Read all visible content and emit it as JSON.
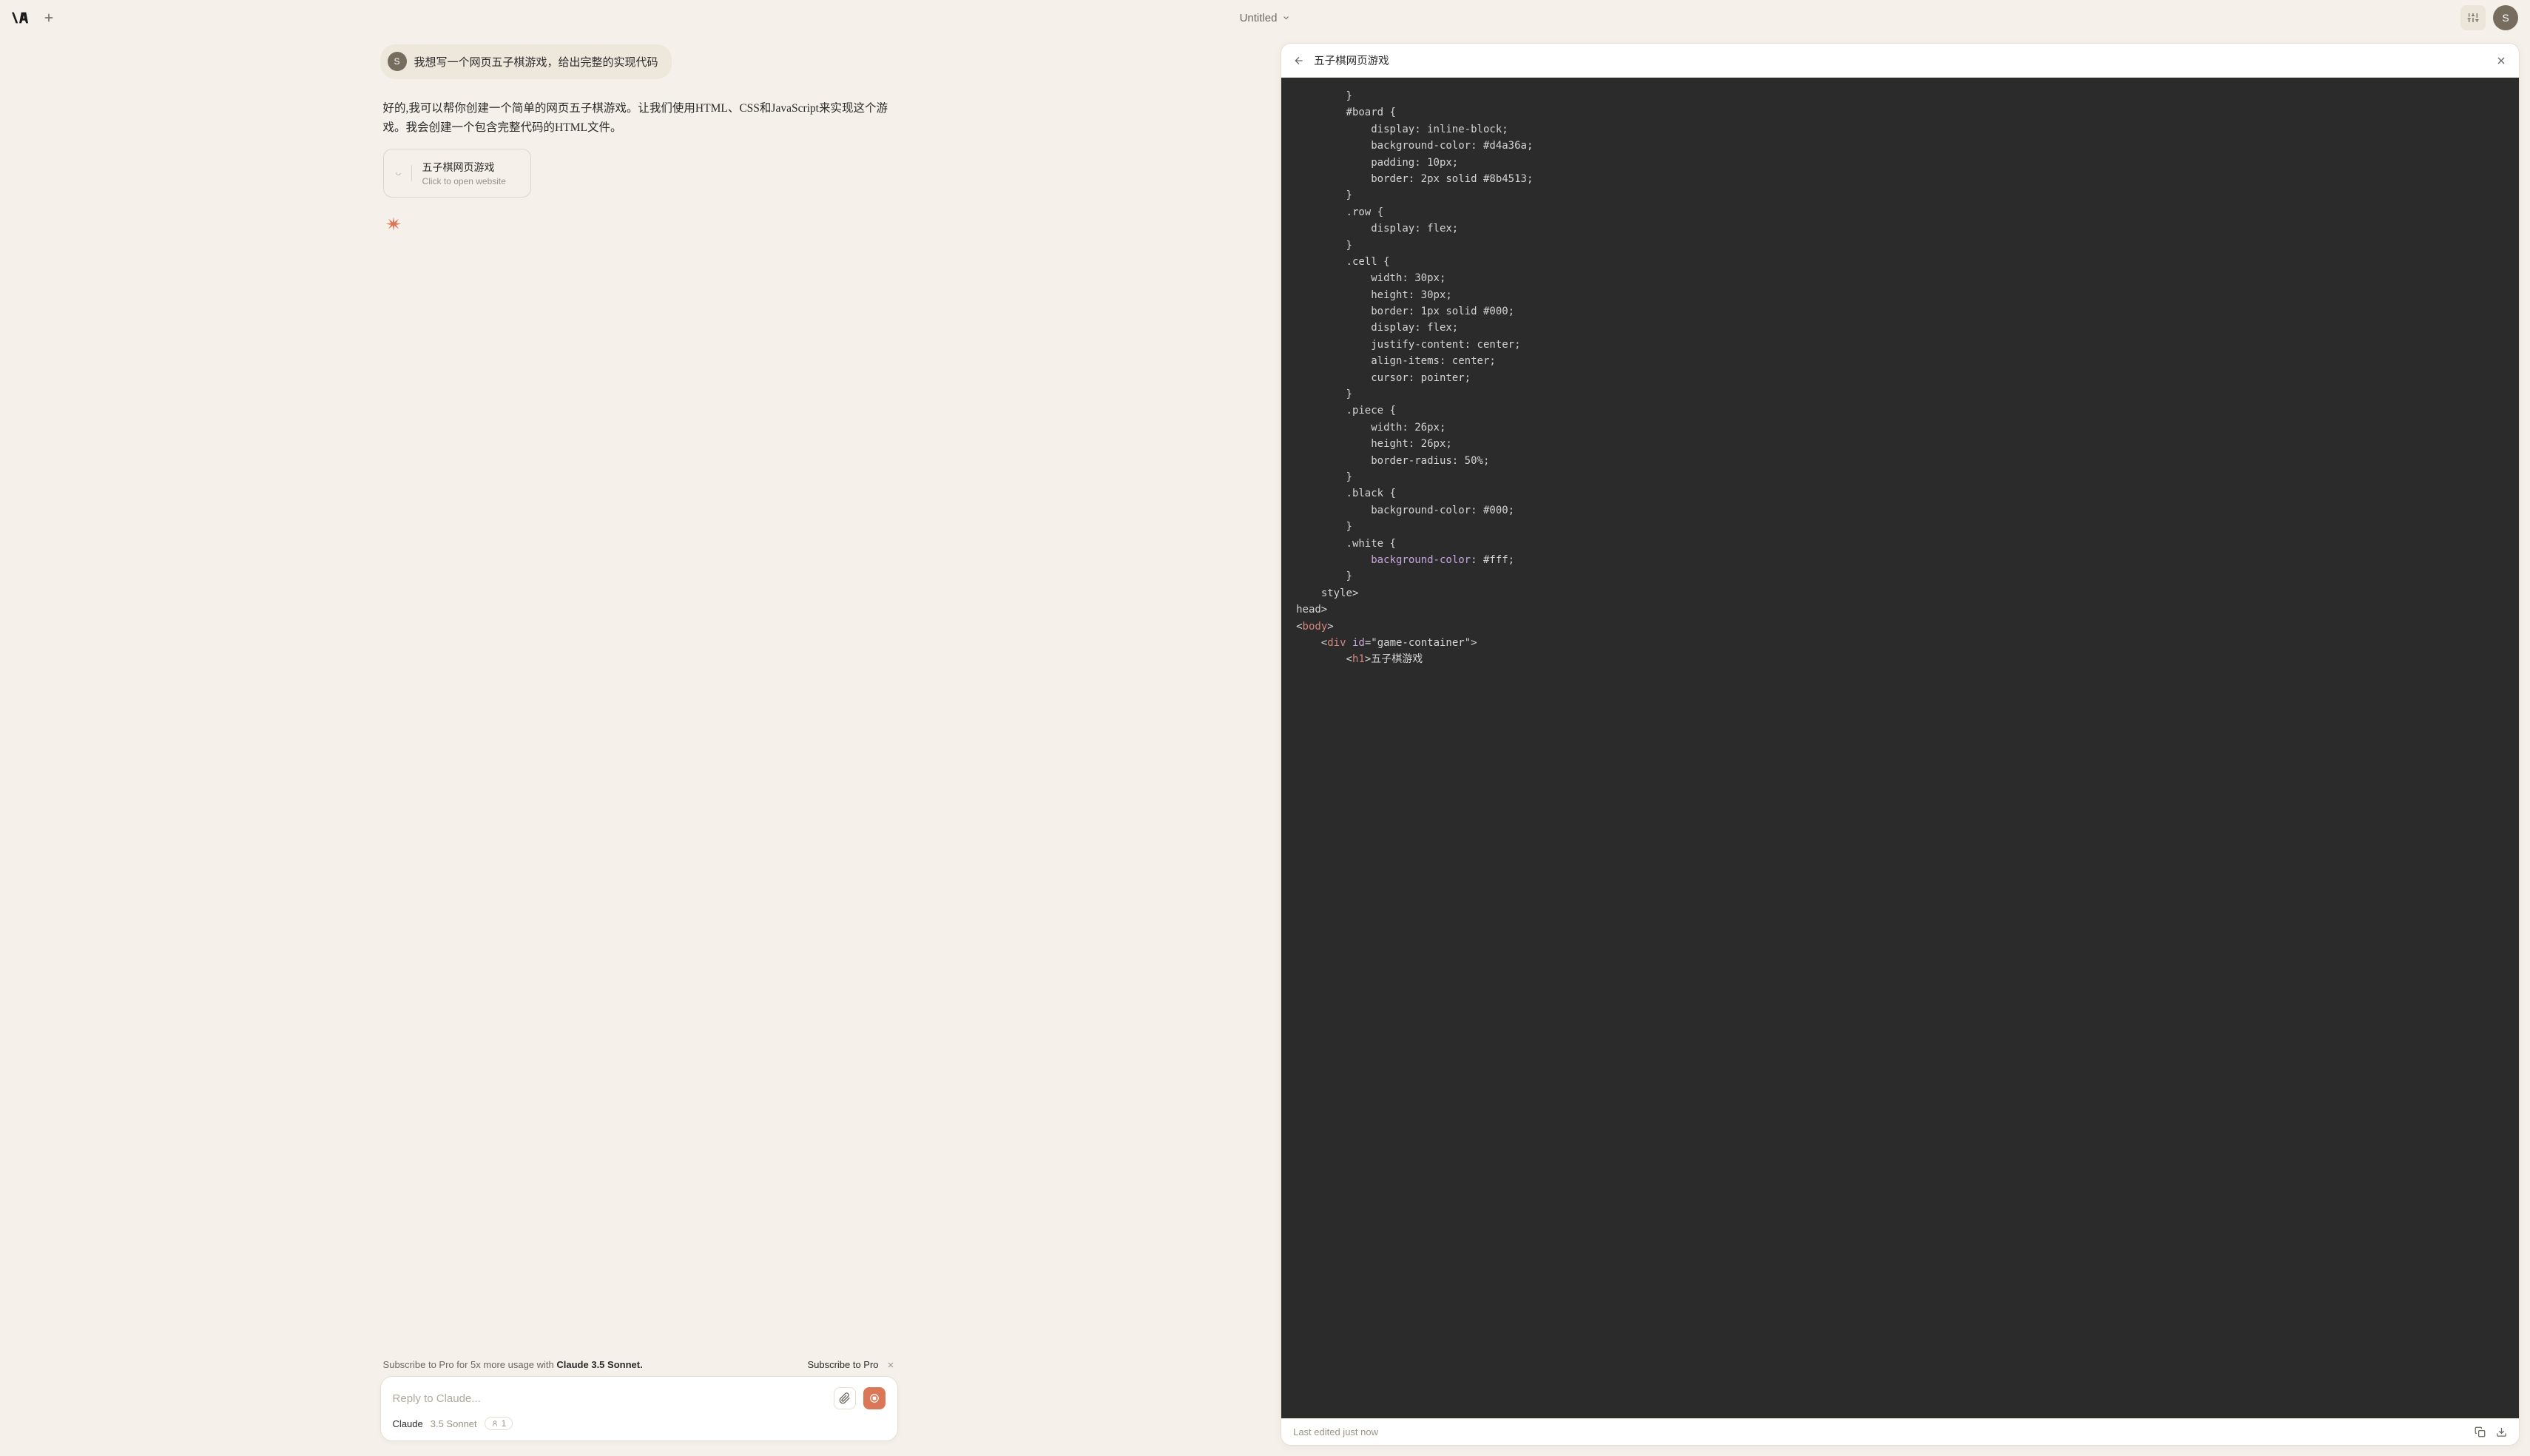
{
  "header": {
    "title": "Untitled",
    "avatar_letter": "S"
  },
  "chat": {
    "user_avatar_letter": "S",
    "user_message": "我想写一个网页五子棋游戏，给出完整的实现代码",
    "assistant_message": "好的,我可以帮你创建一个简单的网页五子棋游戏。让我们使用HTML、CSS和JavaScript来实现这个游戏。我会创建一个包含完整代码的HTML文件。",
    "artifact_card": {
      "title": "五子棋网页游戏",
      "subtitle": "Click to open website"
    }
  },
  "promo": {
    "text_prefix": "Subscribe to Pro for 5x more usage with ",
    "text_bold": "Claude 3.5 Sonnet.",
    "link": "Subscribe to Pro"
  },
  "input": {
    "placeholder": "Reply to Claude...",
    "model_name": "Claude",
    "model_version": "3.5 Sonnet",
    "count": "1"
  },
  "artifact": {
    "title": "五子棋网页游戏",
    "footer_status": "Last edited just now",
    "code_lines": [
      {
        "indent": 8,
        "segments": [
          {
            "t": "}",
            "c": ""
          }
        ]
      },
      {
        "indent": 8,
        "segments": [
          {
            "t": "#board {",
            "c": ""
          }
        ]
      },
      {
        "indent": 12,
        "segments": [
          {
            "t": "display: inline-block;",
            "c": ""
          }
        ]
      },
      {
        "indent": 12,
        "segments": [
          {
            "t": "background-color: #d4a36a;",
            "c": ""
          }
        ]
      },
      {
        "indent": 12,
        "segments": [
          {
            "t": "padding: 10px;",
            "c": ""
          }
        ]
      },
      {
        "indent": 12,
        "segments": [
          {
            "t": "border: 2px solid #8b4513;",
            "c": ""
          }
        ]
      },
      {
        "indent": 8,
        "segments": [
          {
            "t": "}",
            "c": ""
          }
        ]
      },
      {
        "indent": 8,
        "segments": [
          {
            "t": ".row {",
            "c": ""
          }
        ]
      },
      {
        "indent": 12,
        "segments": [
          {
            "t": "display: flex;",
            "c": ""
          }
        ]
      },
      {
        "indent": 8,
        "segments": [
          {
            "t": "}",
            "c": ""
          }
        ]
      },
      {
        "indent": 8,
        "segments": [
          {
            "t": ".cell {",
            "c": ""
          }
        ]
      },
      {
        "indent": 12,
        "segments": [
          {
            "t": "width: 30px;",
            "c": ""
          }
        ]
      },
      {
        "indent": 12,
        "segments": [
          {
            "t": "height: 30px;",
            "c": ""
          }
        ]
      },
      {
        "indent": 12,
        "segments": [
          {
            "t": "border: 1px solid #000;",
            "c": ""
          }
        ]
      },
      {
        "indent": 12,
        "segments": [
          {
            "t": "display: flex;",
            "c": ""
          }
        ]
      },
      {
        "indent": 12,
        "segments": [
          {
            "t": "justify-content: center;",
            "c": ""
          }
        ]
      },
      {
        "indent": 12,
        "segments": [
          {
            "t": "align-items: center;",
            "c": ""
          }
        ]
      },
      {
        "indent": 12,
        "segments": [
          {
            "t": "cursor: pointer;",
            "c": ""
          }
        ]
      },
      {
        "indent": 8,
        "segments": [
          {
            "t": "}",
            "c": ""
          }
        ]
      },
      {
        "indent": 8,
        "segments": [
          {
            "t": ".piece {",
            "c": ""
          }
        ]
      },
      {
        "indent": 12,
        "segments": [
          {
            "t": "width: 26px;",
            "c": ""
          }
        ]
      },
      {
        "indent": 12,
        "segments": [
          {
            "t": "height: 26px;",
            "c": ""
          }
        ]
      },
      {
        "indent": 12,
        "segments": [
          {
            "t": "border-radius: 50%;",
            "c": ""
          }
        ]
      },
      {
        "indent": 8,
        "segments": [
          {
            "t": "}",
            "c": ""
          }
        ]
      },
      {
        "indent": 8,
        "segments": [
          {
            "t": ".black {",
            "c": ""
          }
        ]
      },
      {
        "indent": 12,
        "segments": [
          {
            "t": "background-color: #000;",
            "c": ""
          }
        ]
      },
      {
        "indent": 8,
        "segments": [
          {
            "t": "}",
            "c": ""
          }
        ]
      },
      {
        "indent": 8,
        "segments": [
          {
            "t": ".white {",
            "c": ""
          }
        ]
      },
      {
        "indent": 12,
        "segments": [
          {
            "t": "background-color",
            "c": "prop"
          },
          {
            "t": ": #fff;",
            "c": ""
          }
        ]
      },
      {
        "indent": 8,
        "segments": [
          {
            "t": "}",
            "c": ""
          }
        ]
      },
      {
        "indent": 4,
        "segments": [
          {
            "t": "</",
            "c": ""
          },
          {
            "t": "style",
            "c": "tag"
          },
          {
            "t": ">",
            "c": ""
          }
        ]
      },
      {
        "indent": 0,
        "segments": [
          {
            "t": "</",
            "c": ""
          },
          {
            "t": "head",
            "c": "tag"
          },
          {
            "t": ">",
            "c": ""
          }
        ]
      },
      {
        "indent": 0,
        "segments": [
          {
            "t": "<",
            "c": ""
          },
          {
            "t": "body",
            "c": "tag"
          },
          {
            "t": ">",
            "c": ""
          }
        ]
      },
      {
        "indent": 4,
        "segments": [
          {
            "t": "<",
            "c": ""
          },
          {
            "t": "div",
            "c": "tag"
          },
          {
            "t": " ",
            "c": ""
          },
          {
            "t": "id",
            "c": "prop"
          },
          {
            "t": "=",
            "c": ""
          },
          {
            "t": "\"game-container\"",
            "c": "attr"
          },
          {
            "t": ">",
            "c": ""
          }
        ]
      },
      {
        "indent": 8,
        "segments": [
          {
            "t": "<",
            "c": ""
          },
          {
            "t": "h1",
            "c": "tag"
          },
          {
            "t": ">五子棋游戏",
            "c": ""
          }
        ]
      }
    ]
  }
}
